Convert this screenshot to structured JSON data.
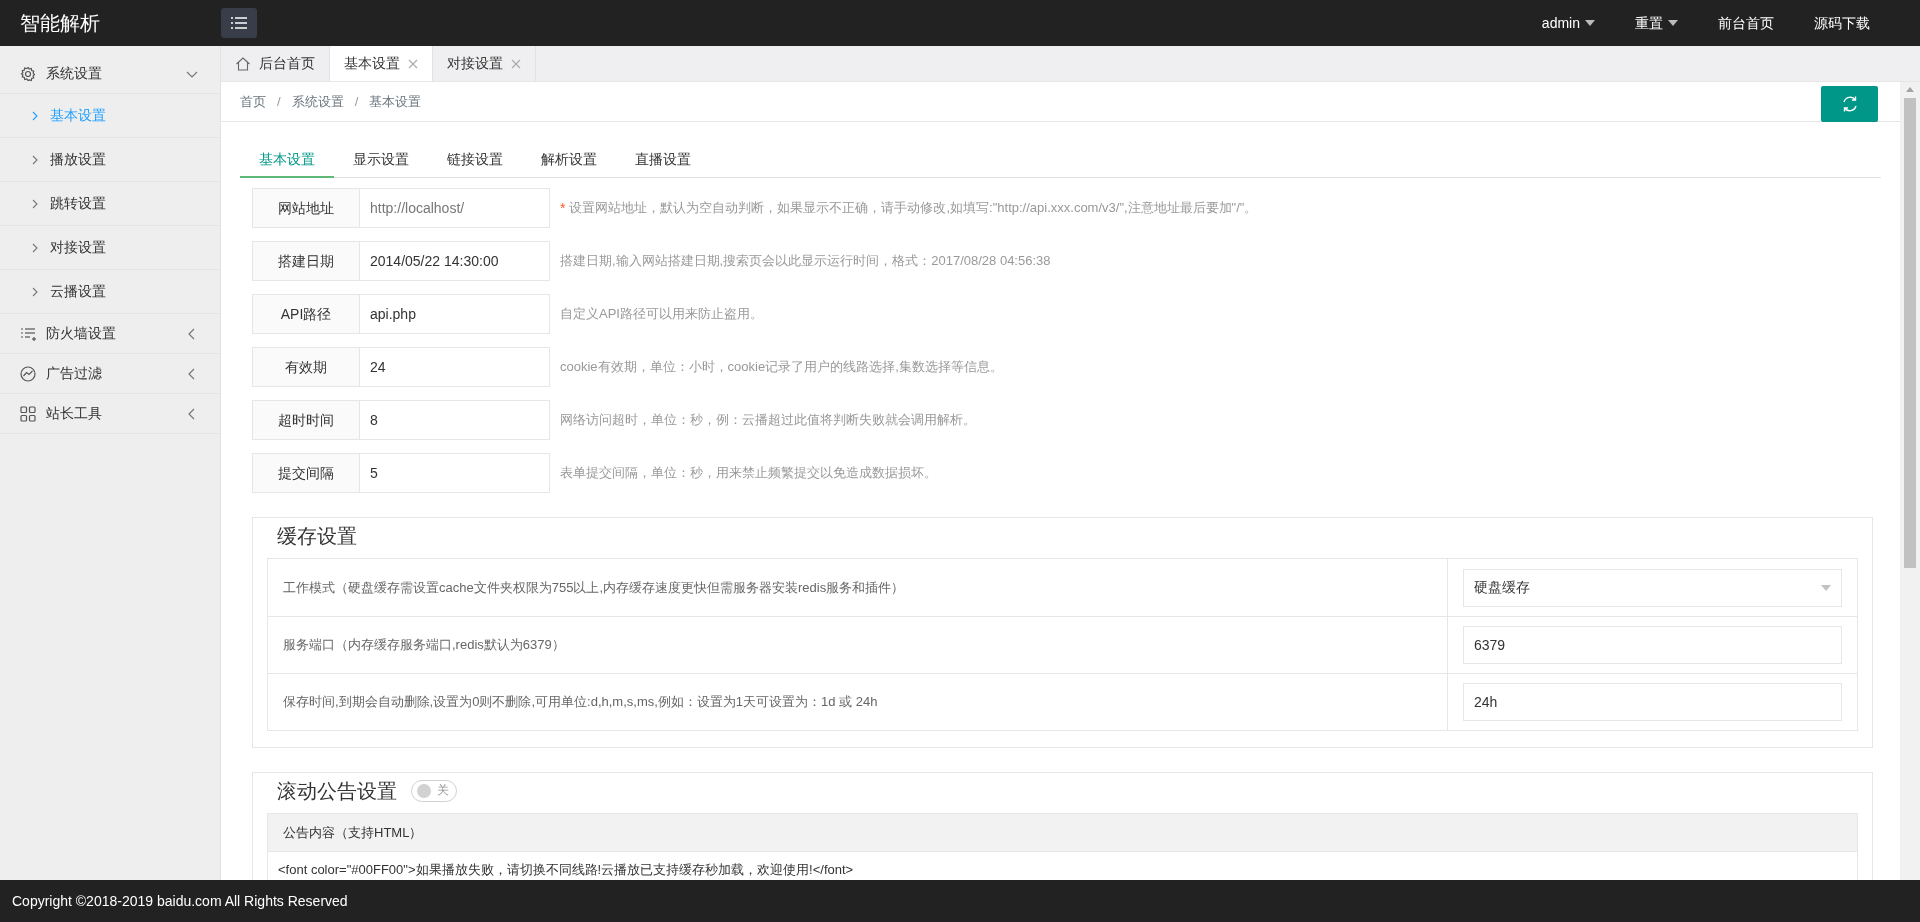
{
  "app": {
    "title": "智能解析"
  },
  "top_nav": [
    {
      "label": "admin",
      "kind": "dropdown"
    },
    {
      "label": "重置",
      "kind": "dropdown"
    },
    {
      "label": "前台首页",
      "kind": "link"
    },
    {
      "label": "源码下载",
      "kind": "link"
    }
  ],
  "sidebar": {
    "items": [
      {
        "label": "系统设置",
        "expanded": true,
        "children": [
          {
            "label": "基本设置",
            "selected": true
          },
          {
            "label": "播放设置",
            "selected": false
          },
          {
            "label": "跳转设置",
            "selected": false
          },
          {
            "label": "对接设置",
            "selected": false
          },
          {
            "label": "云播设置",
            "selected": false
          }
        ]
      },
      {
        "label": "防火墙设置",
        "expanded": false
      },
      {
        "label": "广告过滤",
        "expanded": false
      },
      {
        "label": "站长工具",
        "expanded": false
      }
    ]
  },
  "page_tabs": [
    {
      "label": "后台首页",
      "kind": "home",
      "selected": false
    },
    {
      "label": "基本设置",
      "kind": "closable",
      "selected": true
    },
    {
      "label": "对接设置",
      "kind": "closable",
      "selected": false
    }
  ],
  "breadcrumb": {
    "items": [
      "首页",
      "系统设置",
      "基本设置"
    ],
    "separator": "/"
  },
  "settings_tabs": [
    {
      "label": "基本设置",
      "selected": true
    },
    {
      "label": "显示设置",
      "selected": false
    },
    {
      "label": "链接设置",
      "selected": false
    },
    {
      "label": "解析设置",
      "selected": false
    },
    {
      "label": "直播设置",
      "selected": false
    }
  ],
  "form_rows": [
    {
      "label": "网站地址",
      "placeholder": "http://localhost/",
      "mark": "*",
      "hint": "设置网站地址，默认为空自动判断，如果显示不正确，请手动修改,如填写:\"http://api.xxx.com/v3/\",注意地址最后要加\"/\"。"
    },
    {
      "label": "搭建日期",
      "value": "2014/05/22 14:30:00",
      "hint": "搭建日期,输入网站搭建日期,搜索页会以此显示运行时间，格式：2017/08/28 04:56:38"
    },
    {
      "label": "API路径",
      "value": "api.php",
      "hint": "自定义API路径可以用来防止盗用。"
    },
    {
      "label": "有效期",
      "value": "24",
      "hint": "cookie有效期，单位：小时，cookie记录了用户的线路选择,集数选择等信息。"
    },
    {
      "label": "超时时间",
      "value": "8",
      "hint": "网络访问超时，单位：秒，例：云播超过此值将判断失败就会调用解析。"
    },
    {
      "label": "提交间隔",
      "value": "5",
      "hint": "表单提交间隔，单位：秒，用来禁止频繁提交以免造成数据损坏。"
    }
  ],
  "cache": {
    "legend": "缓存设置",
    "rows": [
      {
        "label": "工作模式（硬盘缓存需设置cache文件夹权限为755以上,内存缓存速度更快但需服务器安装redis服务和插件）",
        "kind": "select",
        "value": "硬盘缓存"
      },
      {
        "label": "服务端口（内存缓存服务端口,redis默认为6379）",
        "kind": "input",
        "value": "6379"
      },
      {
        "label": "保存时间,到期会自动删除,设置为0则不删除,可用单位:d,h,m,s,ms,例如：设置为1天可设置为：1d 或 24h",
        "kind": "input",
        "value": "24h"
      }
    ]
  },
  "notice": {
    "legend": "滚动公告设置",
    "toggle": {
      "on": false,
      "label": "关"
    },
    "header": "公告内容（支持HTML）",
    "content": "<font color=\"#00FF00\">如果播放失败，请切换不同线路!云播放已支持缓存秒加载，欢迎使用!</font>"
  },
  "footer": {
    "text": "Copyright ©2018-2019 baidu.com All Rights Reserved"
  }
}
